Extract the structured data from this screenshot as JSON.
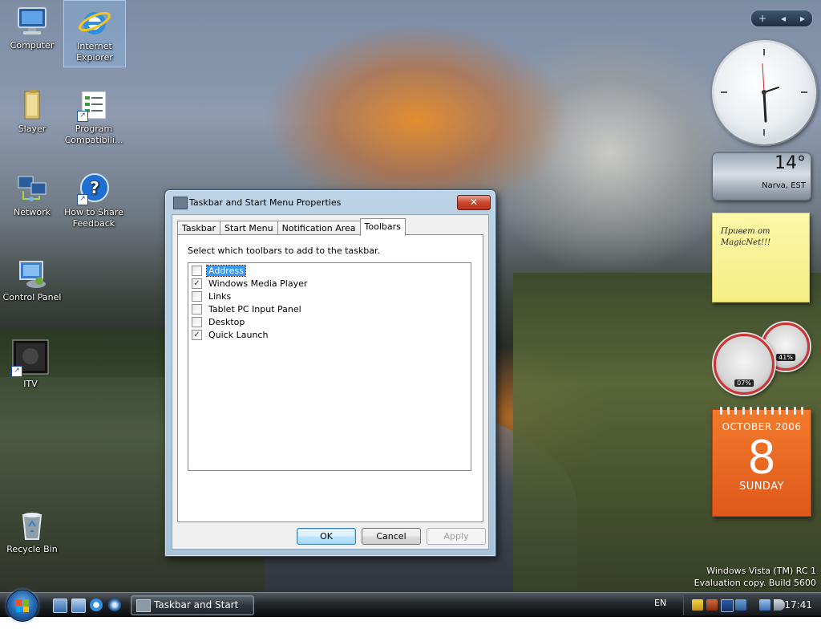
{
  "desktop_icons": [
    {
      "label": "Computer",
      "icon": "computer-icon"
    },
    {
      "label": "Internet Explorer",
      "icon": "internet-explorer-icon"
    },
    {
      "label": "Slayer",
      "icon": "folder-icon"
    },
    {
      "label": "Program Compatibili...",
      "icon": "program-compatibility-icon"
    },
    {
      "label": "Network",
      "icon": "network-icon"
    },
    {
      "label": "How to Share Feedback",
      "icon": "help-icon"
    },
    {
      "label": "Control Panel",
      "icon": "control-panel-icon"
    },
    {
      "label": "ITV",
      "icon": "tv-icon"
    },
    {
      "label": "Recycle Bin",
      "icon": "recycle-bin-icon"
    }
  ],
  "sidebar": {
    "controls": [
      "+",
      "◂",
      "▸"
    ],
    "weather": {
      "temperature": "14°",
      "location": "Narva, EST"
    },
    "note": {
      "line1": "Привет от",
      "line2": "MagicNet!!!"
    },
    "meters": {
      "cpu_percent": "07%",
      "memory_percent": "41%"
    },
    "calendar": {
      "month": "OCTOBER 2006",
      "day": "8",
      "weekday": "SUNDAY"
    }
  },
  "dialog": {
    "title": "Taskbar and Start Menu Properties",
    "close_label": "✕",
    "tabs": [
      "Taskbar",
      "Start Menu",
      "Notification Area",
      "Toolbars"
    ],
    "active_tab": "Toolbars",
    "instruction": "Select which toolbars to add to the taskbar.",
    "toolbars": [
      {
        "label": "Address",
        "checked": false,
        "selected": true
      },
      {
        "label": "Windows Media Player",
        "checked": true,
        "selected": false
      },
      {
        "label": "Links",
        "checked": false,
        "selected": false
      },
      {
        "label": "Tablet PC Input Panel",
        "checked": false,
        "selected": false
      },
      {
        "label": "Desktop",
        "checked": false,
        "selected": false
      },
      {
        "label": "Quick Launch",
        "checked": true,
        "selected": false
      }
    ],
    "buttons": {
      "ok": "OK",
      "cancel": "Cancel",
      "apply": "Apply"
    }
  },
  "watermark": {
    "line1": "Windows Vista (TM) RC 1",
    "line2": "Evaluation copy. Build 5600"
  },
  "taskbar": {
    "start_icon": "windows-logo-icon",
    "quick_launch": [
      "show-desktop-icon",
      "switch-windows-icon",
      "internet-explorer-icon",
      "media-player-icon"
    ],
    "window_button": "Taskbar and Start M...",
    "language": "EN",
    "clock": "17:41"
  },
  "colors": {
    "accent": "#3399ff",
    "calendar": "#e6631f"
  }
}
